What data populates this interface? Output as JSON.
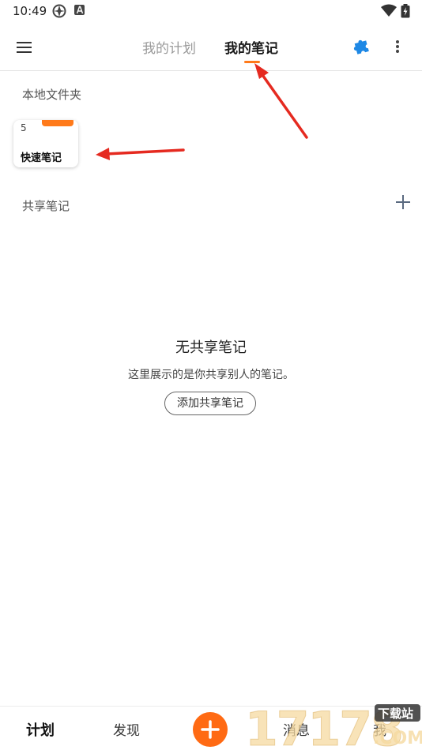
{
  "status_bar": {
    "time": "10:49"
  },
  "header": {
    "tabs": [
      {
        "label": "我的计划",
        "active": false
      },
      {
        "label": "我的笔记",
        "active": true
      }
    ],
    "accent_color": "#ff7a1a",
    "puzzle_color": "#1e88e5"
  },
  "local_folders": {
    "title": "本地文件夹",
    "items": [
      {
        "name": "快速笔记",
        "count": "5"
      }
    ]
  },
  "shared_notes": {
    "title": "共享笔记",
    "empty_title": "无共享笔记",
    "empty_desc": "这里展示的是你共享别人的笔记。",
    "empty_button": "添加共享笔记"
  },
  "bottom_nav": {
    "items": [
      "计划",
      "发现",
      "消息",
      "我"
    ],
    "fab_color": "#ff6a13"
  },
  "watermark": {
    "text": "17178",
    "badge": "下载站",
    "suffix": ".COM"
  }
}
